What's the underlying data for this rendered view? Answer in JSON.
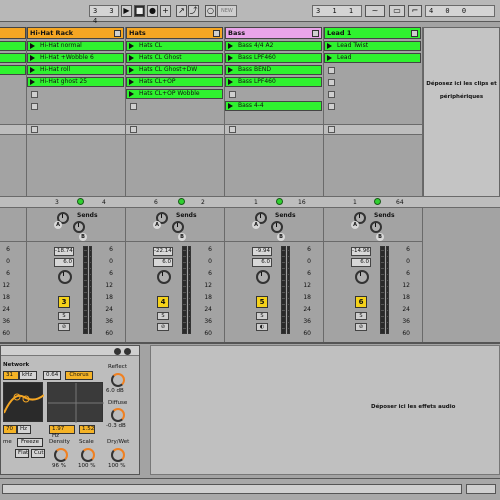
{
  "transport": {
    "position": "3   3   4",
    "loop_start": "3   1   1",
    "loop_length": "4   0   0",
    "new_label": "NEW",
    "play_glyph": "▶",
    "stop_glyph": "■",
    "record_glyph": "●",
    "overdub_glyph": "+"
  },
  "tracks": [
    {
      "name": "Hi-Hat Rack",
      "color": "#f5a623",
      "clips": [
        "Hi-Hat normal",
        "Hi-Hat +Wobble 6",
        "Hi-Hat roll",
        "Hi-Hat ghost 25"
      ],
      "playing": 3,
      "io_left": "3",
      "io_right": "4",
      "volume": "-18.74",
      "pan": "6.0",
      "number": "3",
      "solo": "S",
      "arm": "⊘"
    },
    {
      "name": "Hats",
      "color": "#f5a623",
      "clips": [
        "Hats CL",
        "Hats CL Ghost",
        "Hats CL Ghost+DW",
        "Hats CL+OP",
        "Hats CL+OP Wobble"
      ],
      "playing": 0,
      "io_left": "6",
      "io_right": "2",
      "volume": "-22.14",
      "pan": "6.0",
      "number": "4",
      "solo": "S",
      "arm": "⊘"
    },
    {
      "name": "Bass",
      "color": "#e9a4e9",
      "clips": [
        "Bass 4/4 A2",
        "Bass LPF460",
        "Bass BEND",
        "Bass LPF460",
        "",
        "Bass 4-4"
      ],
      "playing": 3,
      "io_left": "1",
      "io_right": "16",
      "volume": "-9.94",
      "pan": "6.0",
      "number": "5",
      "solo": "S",
      "arm": "◐"
    },
    {
      "name": "Lead 1",
      "color": "#2ff22f",
      "clips": [
        "Lead Twist",
        "Lead"
      ],
      "playing": 1,
      "io_left": "1",
      "io_right": "64",
      "volume": "-14.96",
      "pan": "6.0",
      "number": "6",
      "solo": "S",
      "arm": "⊘"
    }
  ],
  "partial_left": {
    "clips_visible": 3,
    "scale": [
      "6",
      "0",
      "6",
      "12",
      "18",
      "24",
      "36",
      "60"
    ]
  },
  "mixer": {
    "sends_label": "Sends",
    "send_a": "A",
    "send_b": "B",
    "scale": [
      "6",
      "0",
      "6",
      "12",
      "18",
      "24",
      "36",
      "60"
    ],
    "clip_drop_text": "Déposez ici les clips et périphériques"
  },
  "device": {
    "section": "Network",
    "freq1": "31",
    "freq1_unit": "kHz",
    "val2": "0.64",
    "mode": "Chorus",
    "reflect_label": "Reflect",
    "reflect_value": "6.0 dB",
    "diffuse_label": "Diffuse",
    "diffuse_value": "-0.3 dB",
    "hz_value": "70",
    "hz_unit": "Hz",
    "khz_value": "1.97 Hz",
    "rate_value": "1.52",
    "shape_label": "me",
    "freeze_label": "Freeze",
    "flat_label": "Flat",
    "cut_label": "Cut",
    "density_label": "Density",
    "density_value": "96 %",
    "scale_label": "Scale",
    "scale_value": "100 %",
    "drywet_label": "Dry/Wet",
    "drywet_value": "100 %",
    "effects_drop_text": "Déposer ici les effets audio"
  }
}
